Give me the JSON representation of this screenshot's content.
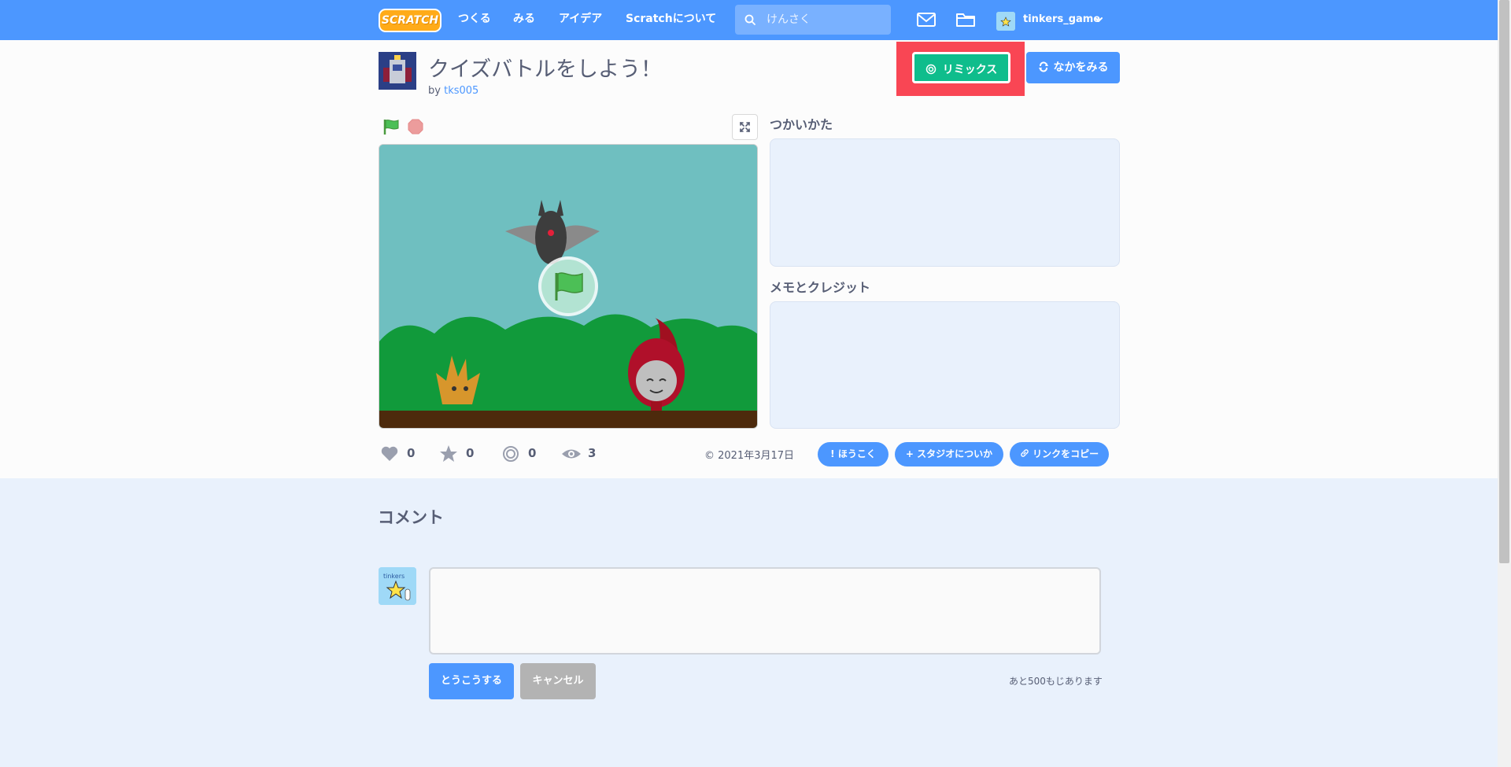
{
  "nav": {
    "logo": "SCRATCH",
    "links": [
      "つくる",
      "みる",
      "アイデア",
      "Scratchについて"
    ],
    "search_placeholder": "けんさく",
    "username": "tinkers_game"
  },
  "project": {
    "title": "クイズバトルをしよう！",
    "by_prefix": "by",
    "author": "tks005",
    "remix_label": "リミックス",
    "see_inside_label": "なかをみる"
  },
  "sections": {
    "instructions_title": "つかいかた",
    "notes_title": "メモとクレジット"
  },
  "stats": {
    "loves": "0",
    "favorites": "0",
    "remixes": "0",
    "views": "3",
    "date": "2021年3月17日"
  },
  "actions": {
    "report": "ほうこく",
    "add_studio": "スタジオについか",
    "copy_link": "リンクをコピー"
  },
  "comments": {
    "title": "コメント",
    "post_label": "とうこうする",
    "cancel_label": "キャンセル",
    "remaining": "あと500もじあります"
  },
  "colors": {
    "nav_blue": "#4c97ff",
    "remix_green": "#0fbd8c",
    "highlight_red": "#f94654"
  }
}
